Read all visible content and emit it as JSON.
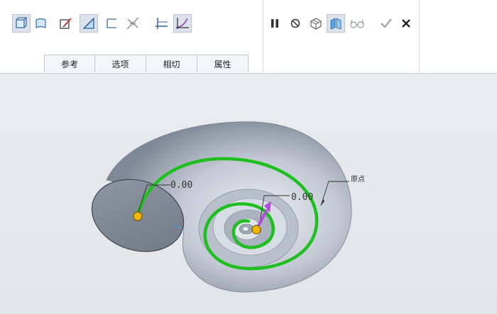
{
  "toolbar": {
    "left_icons": [
      {
        "name": "solid-icon",
        "active": true
      },
      {
        "name": "surface-icon",
        "active": false
      },
      {
        "name": "sketch-icon",
        "active": false
      },
      {
        "name": "remove-material-icon",
        "active": true
      },
      {
        "name": "thicken-icon",
        "active": false
      },
      {
        "name": "flip-direction-icon",
        "active": false
      },
      {
        "name": "constant-section-icon",
        "active": false
      },
      {
        "name": "variable-section-icon",
        "active": true
      }
    ],
    "right_icons": [
      {
        "name": "pause-icon"
      },
      {
        "name": "no-preview-icon"
      },
      {
        "name": "verify-mode-icon"
      },
      {
        "name": "feature-preview-icon",
        "active": true
      },
      {
        "name": "glasses-icon"
      },
      {
        "name": "confirm-check-icon"
      },
      {
        "name": "cancel-x-icon"
      }
    ]
  },
  "tabs": [
    "参考",
    "选项",
    "相切",
    "属性"
  ],
  "viewport": {
    "dimension_left": "0.00",
    "dimension_center": "0.00",
    "origin_label": "原点",
    "colors": {
      "background": "#e6e8eb",
      "shell": "#aeb6c2",
      "trajectory": "#1fbf1f",
      "point": "#f2b705",
      "arrow": "#b04fd6"
    }
  }
}
